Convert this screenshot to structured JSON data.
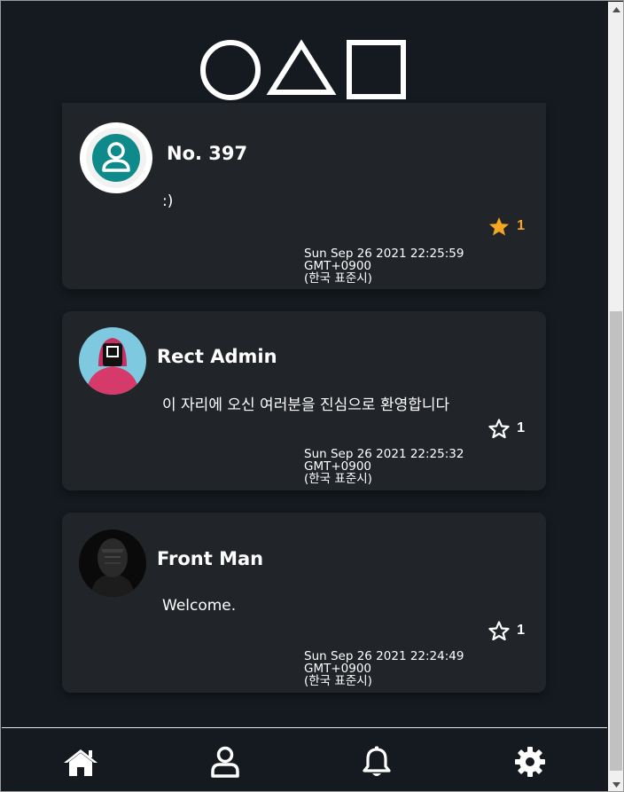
{
  "app": {
    "logo_icons": [
      "circle-icon",
      "triangle-icon",
      "square-icon"
    ]
  },
  "feed": {
    "posts": [
      {
        "author": "No. 397",
        "message": ":)",
        "likes": "1",
        "liked": true,
        "timestamp_line1": "Sun Sep 26 2021 22:25:59 GMT+0900",
        "timestamp_line2": "(한국 표준시)",
        "avatar": "default-user-icon"
      },
      {
        "author": "Rect Admin",
        "message": "이 자리에 오신 여러분을 진심으로 환영합니다",
        "likes": "1",
        "liked": false,
        "timestamp_line1": "Sun Sep 26 2021 22:25:32 GMT+0900",
        "timestamp_line2": "(한국 표준시)",
        "avatar": "pink-guard-avatar"
      },
      {
        "author": "Front Man",
        "message": "Welcome.",
        "likes": "1",
        "liked": false,
        "timestamp_line1": "Sun Sep 26 2021 22:24:49 GMT+0900",
        "timestamp_line2": "(한국 표준시)",
        "avatar": "front-man-avatar"
      }
    ]
  },
  "nav": {
    "items": [
      "home-icon",
      "profile-icon",
      "bell-icon",
      "gear-icon"
    ]
  },
  "colors": {
    "background": "#141a1f",
    "card": "#212429",
    "liked": "#f5a623",
    "default_avatar": "#0f8a8a"
  }
}
